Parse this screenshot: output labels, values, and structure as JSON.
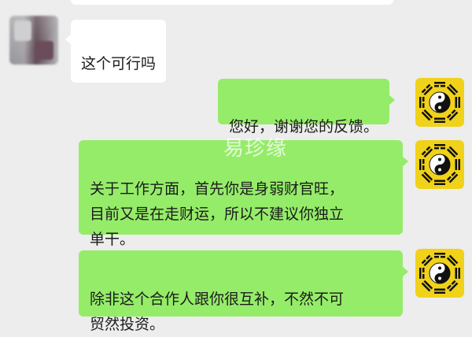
{
  "watermark": "易珍缘",
  "messages": [
    {
      "side": "in",
      "text": "这个可行吗"
    },
    {
      "side": "out",
      "text": "您好，谢谢您的反馈。"
    },
    {
      "side": "out",
      "text": "关于工作方面，首先你是身弱财官旺，\n目前又是在走财运，所以不建议你独立\n单干。"
    },
    {
      "side": "out",
      "text": "除非这个合作人跟你很互补，不然不可\n贸然投资。"
    }
  ],
  "avatars": {
    "contact": {
      "icon": "blurred-avatar"
    },
    "self": {
      "icon": "bagua-yin-yang-icon"
    }
  },
  "colors": {
    "chat_background": "#ededed",
    "incoming_bubble": "#ffffff",
    "outgoing_bubble": "#95ec69",
    "avatar_yellow": "#f0d21a"
  }
}
